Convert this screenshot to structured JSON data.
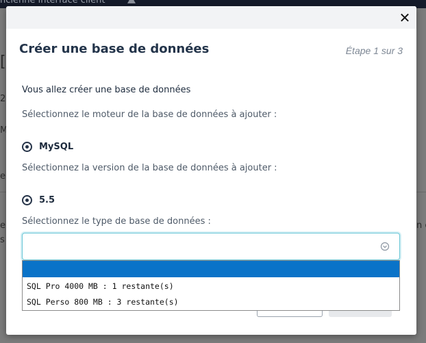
{
  "background": {
    "topbar_text": "ncienne interface client",
    "fragments": {
      "left_1": "[",
      "left_2": "2(",
      "left_3": "M",
      "left_4": "e",
      "left_5": "e",
      "left_6": "s",
      "right_1": "n c"
    }
  },
  "modal": {
    "close_label": "✕",
    "title": "Créer une base de données",
    "step": "Étape 1 sur 3",
    "intro": "Vous allez créer une base de données",
    "engine_label": "Sélectionnez le moteur de la base de données à ajouter :",
    "engine_value": "MySQL",
    "version_label": "Sélectionnez la version de la base de données à ajouter :",
    "version_value": "5.5",
    "type_label": "Sélectionnez le type de base de données :",
    "type_select": {
      "selected": "",
      "options": [
        "",
        "SQL Pro 4000 MB : 1 restante(s)",
        "SQL Perso 800 MB : 3 restante(s)"
      ]
    }
  },
  "colors": {
    "accent_focus": "#6ac6d6",
    "option_highlight": "#0a73c8",
    "title": "#23344a"
  },
  "icons": {
    "close": "close-icon",
    "warning": "warning-icon",
    "chevron": "chevron-down-icon"
  }
}
